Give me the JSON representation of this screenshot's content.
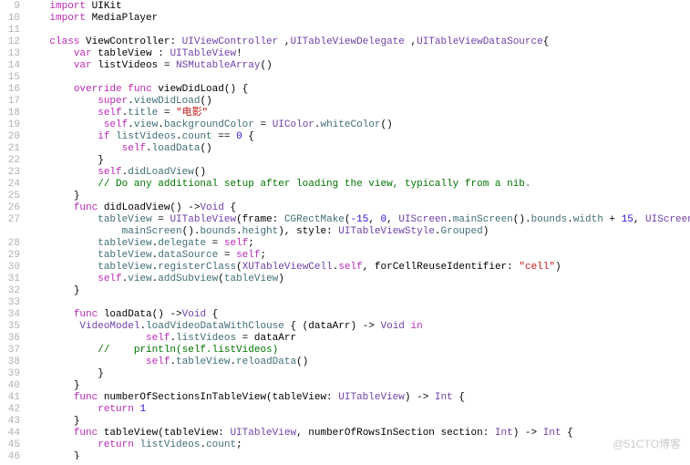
{
  "lineStart": 9,
  "lineEnd": 46,
  "watermark": "@51CTO博客",
  "code": {
    "l9": {
      "indent": 1,
      "tokens": [
        [
          "kw",
          "import"
        ],
        [
          "plain",
          " UIKit"
        ]
      ]
    },
    "l10": {
      "indent": 1,
      "tokens": [
        [
          "kw",
          "import"
        ],
        [
          "plain",
          " MediaPlayer"
        ]
      ]
    },
    "l11": {
      "indent": 0,
      "tokens": []
    },
    "l12": {
      "indent": 1,
      "tokens": [
        [
          "kw",
          "class"
        ],
        [
          "plain",
          " ViewController: "
        ],
        [
          "type",
          "UIViewController"
        ],
        [
          "plain",
          " ,"
        ],
        [
          "type",
          "UITableViewDelegate"
        ],
        [
          "plain",
          " ,"
        ],
        [
          "type",
          "UITableViewDataSource"
        ],
        [
          "plain",
          "{"
        ]
      ]
    },
    "l13": {
      "indent": 2,
      "tokens": [
        [
          "kw",
          "var"
        ],
        [
          "plain",
          " tableView : "
        ],
        [
          "type",
          "UITableView"
        ],
        [
          "plain",
          "!"
        ]
      ]
    },
    "l14": {
      "indent": 2,
      "tokens": [
        [
          "kw",
          "var"
        ],
        [
          "plain",
          " listVideos = "
        ],
        [
          "type",
          "NSMutableArray"
        ],
        [
          "plain",
          "()"
        ]
      ]
    },
    "l15": {
      "indent": 0,
      "tokens": []
    },
    "l16": {
      "indent": 2,
      "tokens": [
        [
          "kw",
          "override"
        ],
        [
          "plain",
          " "
        ],
        [
          "kw",
          "func"
        ],
        [
          "plain",
          " viewDidLoad() {"
        ]
      ]
    },
    "l17": {
      "indent": 3,
      "tokens": [
        [
          "kw",
          "super"
        ],
        [
          "plain",
          "."
        ],
        [
          "method",
          "viewDidLoad"
        ],
        [
          "plain",
          "()"
        ]
      ]
    },
    "l18": {
      "indent": 3,
      "tokens": [
        [
          "kw",
          "self"
        ],
        [
          "plain",
          "."
        ],
        [
          "prop",
          "title"
        ],
        [
          "plain",
          " = "
        ],
        [
          "str",
          "\"电影\""
        ]
      ]
    },
    "l19": {
      "indent": 3,
      "tokens": [
        [
          "plain",
          " "
        ],
        [
          "kw",
          "self"
        ],
        [
          "plain",
          "."
        ],
        [
          "prop",
          "view"
        ],
        [
          "plain",
          "."
        ],
        [
          "prop",
          "backgroundColor"
        ],
        [
          "plain",
          " = "
        ],
        [
          "type",
          "UIColor"
        ],
        [
          "plain",
          "."
        ],
        [
          "method",
          "whiteColor"
        ],
        [
          "plain",
          "()"
        ]
      ]
    },
    "l20": {
      "indent": 3,
      "tokens": [
        [
          "kw",
          "if"
        ],
        [
          "plain",
          " "
        ],
        [
          "prop",
          "listVideos"
        ],
        [
          "plain",
          "."
        ],
        [
          "prop",
          "count"
        ],
        [
          "plain",
          " == "
        ],
        [
          "num",
          "0"
        ],
        [
          "plain",
          " {"
        ]
      ]
    },
    "l21": {
      "indent": 4,
      "tokens": [
        [
          "kw",
          "self"
        ],
        [
          "plain",
          "."
        ],
        [
          "method",
          "loadData"
        ],
        [
          "plain",
          "()"
        ]
      ]
    },
    "l22": {
      "indent": 3,
      "tokens": [
        [
          "plain",
          "}"
        ]
      ]
    },
    "l23": {
      "indent": 3,
      "tokens": [
        [
          "kw",
          "self"
        ],
        [
          "plain",
          "."
        ],
        [
          "method",
          "didLoadView"
        ],
        [
          "plain",
          "()"
        ]
      ]
    },
    "l24": {
      "indent": 3,
      "tokens": [
        [
          "comment",
          "// Do any additional setup after loading the view, typically from a nib."
        ]
      ]
    },
    "l25": {
      "indent": 2,
      "tokens": [
        [
          "plain",
          "}"
        ]
      ]
    },
    "l26": {
      "indent": 2,
      "tokens": [
        [
          "kw",
          "func"
        ],
        [
          "plain",
          " didLoadView() ->"
        ],
        [
          "type",
          "Void"
        ],
        [
          "plain",
          " {"
        ]
      ]
    },
    "l27": {
      "indent": 3,
      "tokens": [
        [
          "prop",
          "tableView"
        ],
        [
          "plain",
          " = "
        ],
        [
          "type",
          "UITableView"
        ],
        [
          "plain",
          "(frame: "
        ],
        [
          "method",
          "CGRectMake"
        ],
        [
          "plain",
          "("
        ],
        [
          "num",
          "-15"
        ],
        [
          "plain",
          ", "
        ],
        [
          "num",
          "0"
        ],
        [
          "plain",
          ", "
        ],
        [
          "type",
          "UIScreen"
        ],
        [
          "plain",
          "."
        ],
        [
          "method",
          "mainScreen"
        ],
        [
          "plain",
          "()."
        ],
        [
          "prop",
          "bounds"
        ],
        [
          "plain",
          "."
        ],
        [
          "prop",
          "width"
        ],
        [
          "plain",
          " + "
        ],
        [
          "num",
          "15"
        ],
        [
          "plain",
          ", "
        ],
        [
          "type",
          "UIScreen"
        ],
        [
          "plain",
          "."
        ]
      ]
    },
    "l27b": {
      "indent": 4,
      "tokens": [
        [
          "method",
          "mainScreen"
        ],
        [
          "plain",
          "()."
        ],
        [
          "prop",
          "bounds"
        ],
        [
          "plain",
          "."
        ],
        [
          "prop",
          "height"
        ],
        [
          "plain",
          "), style: "
        ],
        [
          "type",
          "UITableViewStyle"
        ],
        [
          "plain",
          "."
        ],
        [
          "prop",
          "Grouped"
        ],
        [
          "plain",
          ")"
        ]
      ]
    },
    "l28": {
      "indent": 3,
      "tokens": [
        [
          "prop",
          "tableView"
        ],
        [
          "plain",
          "."
        ],
        [
          "prop",
          "delegate"
        ],
        [
          "plain",
          " = "
        ],
        [
          "kw",
          "self"
        ],
        [
          "plain",
          ";"
        ]
      ]
    },
    "l29": {
      "indent": 3,
      "tokens": [
        [
          "prop",
          "tableView"
        ],
        [
          "plain",
          "."
        ],
        [
          "prop",
          "dataSource"
        ],
        [
          "plain",
          " = "
        ],
        [
          "kw",
          "self"
        ],
        [
          "plain",
          ";"
        ]
      ]
    },
    "l30": {
      "indent": 3,
      "tokens": [
        [
          "prop",
          "tableView"
        ],
        [
          "plain",
          "."
        ],
        [
          "method",
          "registerClass"
        ],
        [
          "plain",
          "("
        ],
        [
          "type",
          "XUTableViewCell"
        ],
        [
          "plain",
          "."
        ],
        [
          "kw",
          "self"
        ],
        [
          "plain",
          ", forCellReuseIdentifier: "
        ],
        [
          "str",
          "\"cell\""
        ],
        [
          "plain",
          ")"
        ]
      ]
    },
    "l31": {
      "indent": 3,
      "tokens": [
        [
          "kw",
          "self"
        ],
        [
          "plain",
          "."
        ],
        [
          "prop",
          "view"
        ],
        [
          "plain",
          "."
        ],
        [
          "method",
          "addSubview"
        ],
        [
          "plain",
          "("
        ],
        [
          "prop",
          "tableView"
        ],
        [
          "plain",
          ")"
        ]
      ]
    },
    "l32": {
      "indent": 2,
      "tokens": [
        [
          "plain",
          "}"
        ]
      ]
    },
    "l33": {
      "indent": 0,
      "tokens": []
    },
    "l34": {
      "indent": 2,
      "tokens": [
        [
          "kw",
          "func"
        ],
        [
          "plain",
          " loadData() ->"
        ],
        [
          "type",
          "Void"
        ],
        [
          "plain",
          " {"
        ]
      ]
    },
    "l35": {
      "indent": 2,
      "tokens": [
        [
          "plain",
          " "
        ],
        [
          "type",
          "VideoModel"
        ],
        [
          "plain",
          "."
        ],
        [
          "method",
          "loadVideoDataWithClouse"
        ],
        [
          "plain",
          " { (dataArr) -> "
        ],
        [
          "type",
          "Void"
        ],
        [
          "plain",
          " "
        ],
        [
          "kw",
          "in"
        ]
      ]
    },
    "l36": {
      "indent": 5,
      "tokens": [
        [
          "kw",
          "self"
        ],
        [
          "plain",
          "."
        ],
        [
          "prop",
          "listVideos"
        ],
        [
          "plain",
          " = dataArr"
        ]
      ]
    },
    "l37": {
      "indent": 3,
      "tokens": [
        [
          "comment",
          "//    println(self.listVideos)"
        ]
      ]
    },
    "l38": {
      "indent": 5,
      "tokens": [
        [
          "kw",
          "self"
        ],
        [
          "plain",
          "."
        ],
        [
          "prop",
          "tableView"
        ],
        [
          "plain",
          "."
        ],
        [
          "method",
          "reloadData"
        ],
        [
          "plain",
          "()"
        ]
      ]
    },
    "l39": {
      "indent": 3,
      "tokens": [
        [
          "plain",
          "}"
        ]
      ]
    },
    "l40": {
      "indent": 2,
      "tokens": [
        [
          "plain",
          "}"
        ]
      ]
    },
    "l41": {
      "indent": 2,
      "tokens": [
        [
          "kw",
          "func"
        ],
        [
          "plain",
          " numberOfSectionsInTableView(tableView: "
        ],
        [
          "type",
          "UITableView"
        ],
        [
          "plain",
          ") -> "
        ],
        [
          "type",
          "Int"
        ],
        [
          "plain",
          " {"
        ]
      ]
    },
    "l42": {
      "indent": 3,
      "tokens": [
        [
          "kw",
          "return"
        ],
        [
          "plain",
          " "
        ],
        [
          "num",
          "1"
        ]
      ]
    },
    "l43": {
      "indent": 2,
      "tokens": [
        [
          "plain",
          "}"
        ]
      ]
    },
    "l44": {
      "indent": 2,
      "tokens": [
        [
          "kw",
          "func"
        ],
        [
          "plain",
          " tableView(tableView: "
        ],
        [
          "type",
          "UITableView"
        ],
        [
          "plain",
          ", numberOfRowsInSection section: "
        ],
        [
          "type",
          "Int"
        ],
        [
          "plain",
          ") -> "
        ],
        [
          "type",
          "Int"
        ],
        [
          "plain",
          " {"
        ]
      ]
    },
    "l45": {
      "indent": 3,
      "tokens": [
        [
          "kw",
          "return"
        ],
        [
          "plain",
          " "
        ],
        [
          "prop",
          "listVideos"
        ],
        [
          "plain",
          "."
        ],
        [
          "prop",
          "count"
        ],
        [
          "plain",
          ";"
        ]
      ]
    },
    "l46": {
      "indent": 2,
      "tokens": [
        [
          "plain",
          "}"
        ]
      ]
    }
  },
  "indentUnit": "    "
}
